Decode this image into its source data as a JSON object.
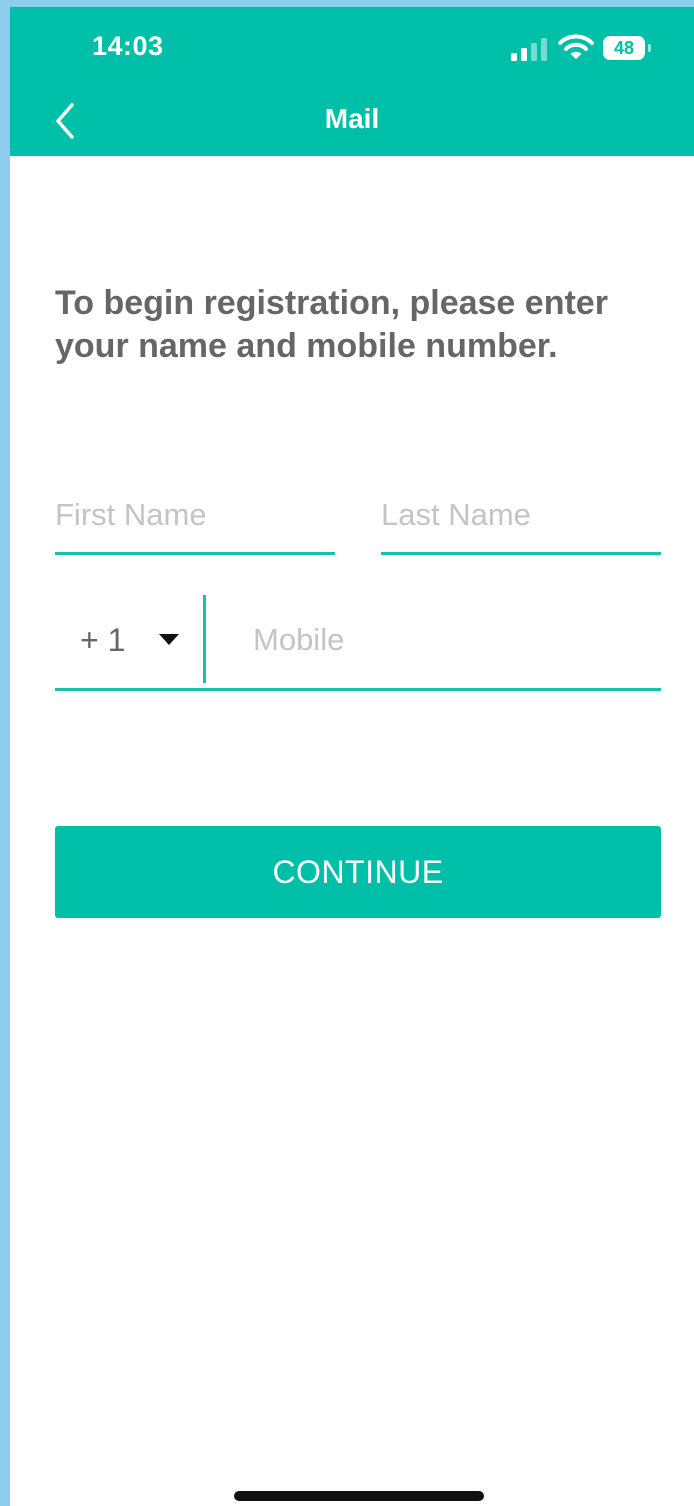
{
  "status_bar": {
    "time": "14:03",
    "battery": "48"
  },
  "header": {
    "title": "Mail",
    "back_icon": "chevron-left-icon"
  },
  "registration": {
    "prompt": "To begin registration, please enter your name and mobile number.",
    "first_name_placeholder": "First Name",
    "last_name_placeholder": "Last Name",
    "country_code": "+ 1",
    "mobile_placeholder": "Mobile",
    "continue_label": "CONTINUE"
  },
  "colors": {
    "accent": "#00bfa9",
    "underline": "#16bfae",
    "prompt_text": "#666666",
    "placeholder": "#c4c4c4",
    "outer_background": "#8fcdee"
  }
}
